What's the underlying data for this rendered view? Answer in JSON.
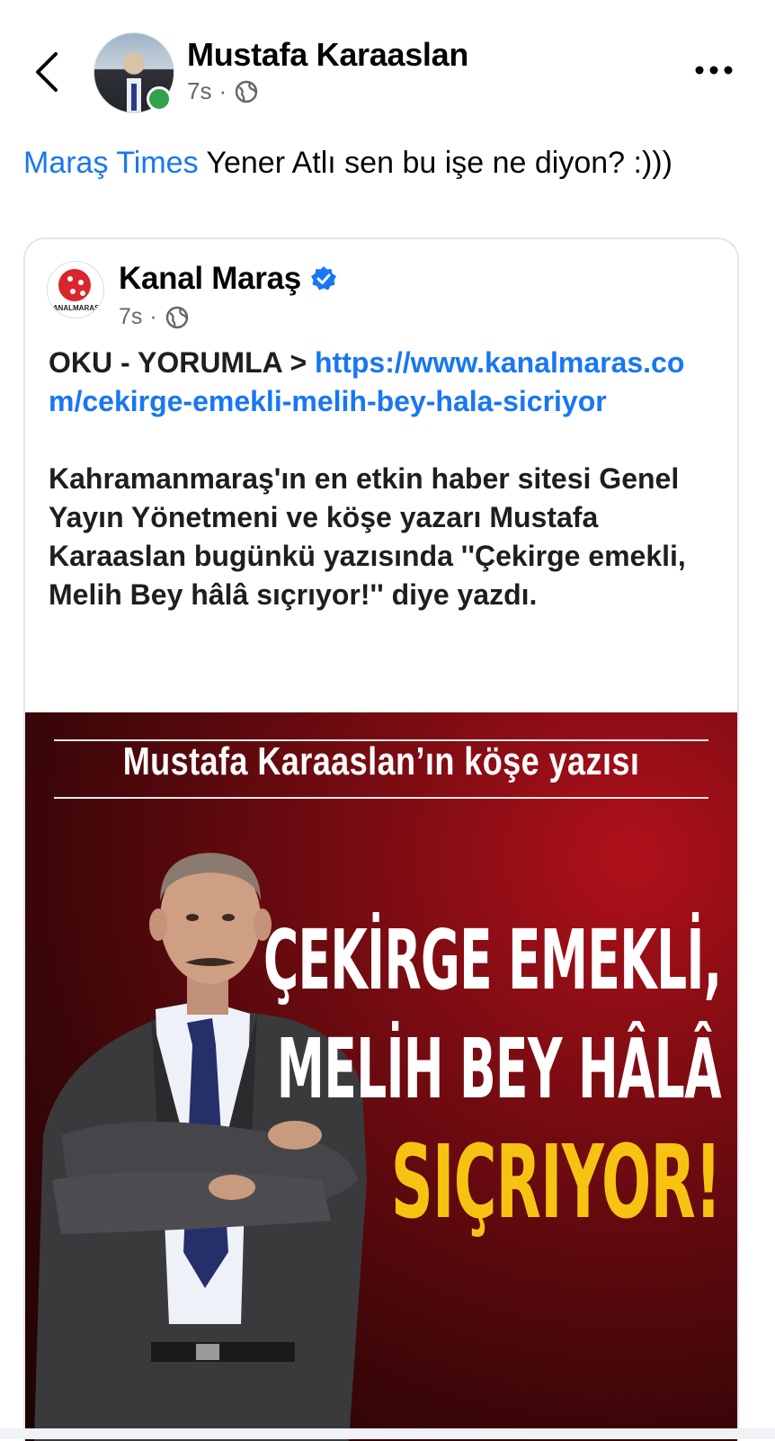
{
  "header": {
    "author_name": "Mustafa Karaaslan",
    "time": "7s",
    "dot": "·",
    "icons": [
      "back-arrow-icon",
      "online-status",
      "globe-icon",
      "more-options-icon"
    ],
    "online_color": "#31a24c"
  },
  "post": {
    "mention": "Maraş Times",
    "text": " Yener Atlı sen bu işe ne diyon? :)))",
    "mention_color": "#1877f2"
  },
  "shared": {
    "page_name": "Kanal Maraş",
    "logo_text": "KANALMARAS.COM",
    "time": "7s",
    "dot": "·",
    "verified_color": "#1877f2",
    "lead": "OKU - YORUMLA > ",
    "link": "https://www.kanalmaras.com/cekirge-emekli-melih-bey-hala-sicriyor",
    "body": "Kahramanmaraş'ın en etkin haber sitesi Genel Yayın Yönetmeni ve köşe yazarı Mustafa Karaaslan bugünkü yazısında ''Çekirge emekli, Melih Bey hâlâ sıçrıyor!'' diye yazdı."
  },
  "image": {
    "kicker": "Mustafa Karaaslan’ın köşe yazısı",
    "headline_line1": "ÇEKİRGE EMEKLİ,",
    "headline_line2": "MELİH BEY HÂLÂ",
    "headline_line3": "SIÇRIYOR!",
    "accent_color": "#f7c312",
    "background_color": "#7a0c12"
  }
}
